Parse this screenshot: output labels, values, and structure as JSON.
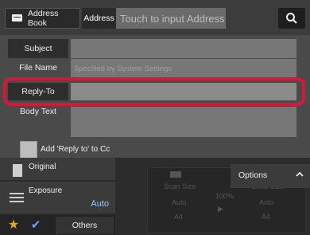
{
  "header": {
    "address_book_label": "Address Book",
    "address_tab_label": "Address",
    "address_placeholder": "Touch to input Address"
  },
  "form": {
    "subject_label": "Subject",
    "subject_value": "",
    "file_name_label": "File Name",
    "file_name_placeholder": "Specified by System Settings",
    "reply_to_label": "Reply-To",
    "reply_to_value": "",
    "body_text_label": "Body Text",
    "body_text_value": "",
    "cc_checkbox_label": "Add 'Reply to' to Cc"
  },
  "bottom": {
    "original_label": "Original",
    "exposure_label": "Exposure",
    "exposure_value": "Auto",
    "others_label": "Others",
    "options_label": "Options",
    "preview": {
      "scan_size_label": "Scan Size",
      "send_size_label": "Send Size",
      "ratio": "100%",
      "scan_auto": "Auto",
      "scan_paper": "A4",
      "send_auto": "Auto",
      "send_paper": "A4"
    }
  },
  "colors": {
    "highlight": "#d6193a",
    "accent_value": "#9ec9ff",
    "star": "#e3a52a"
  }
}
